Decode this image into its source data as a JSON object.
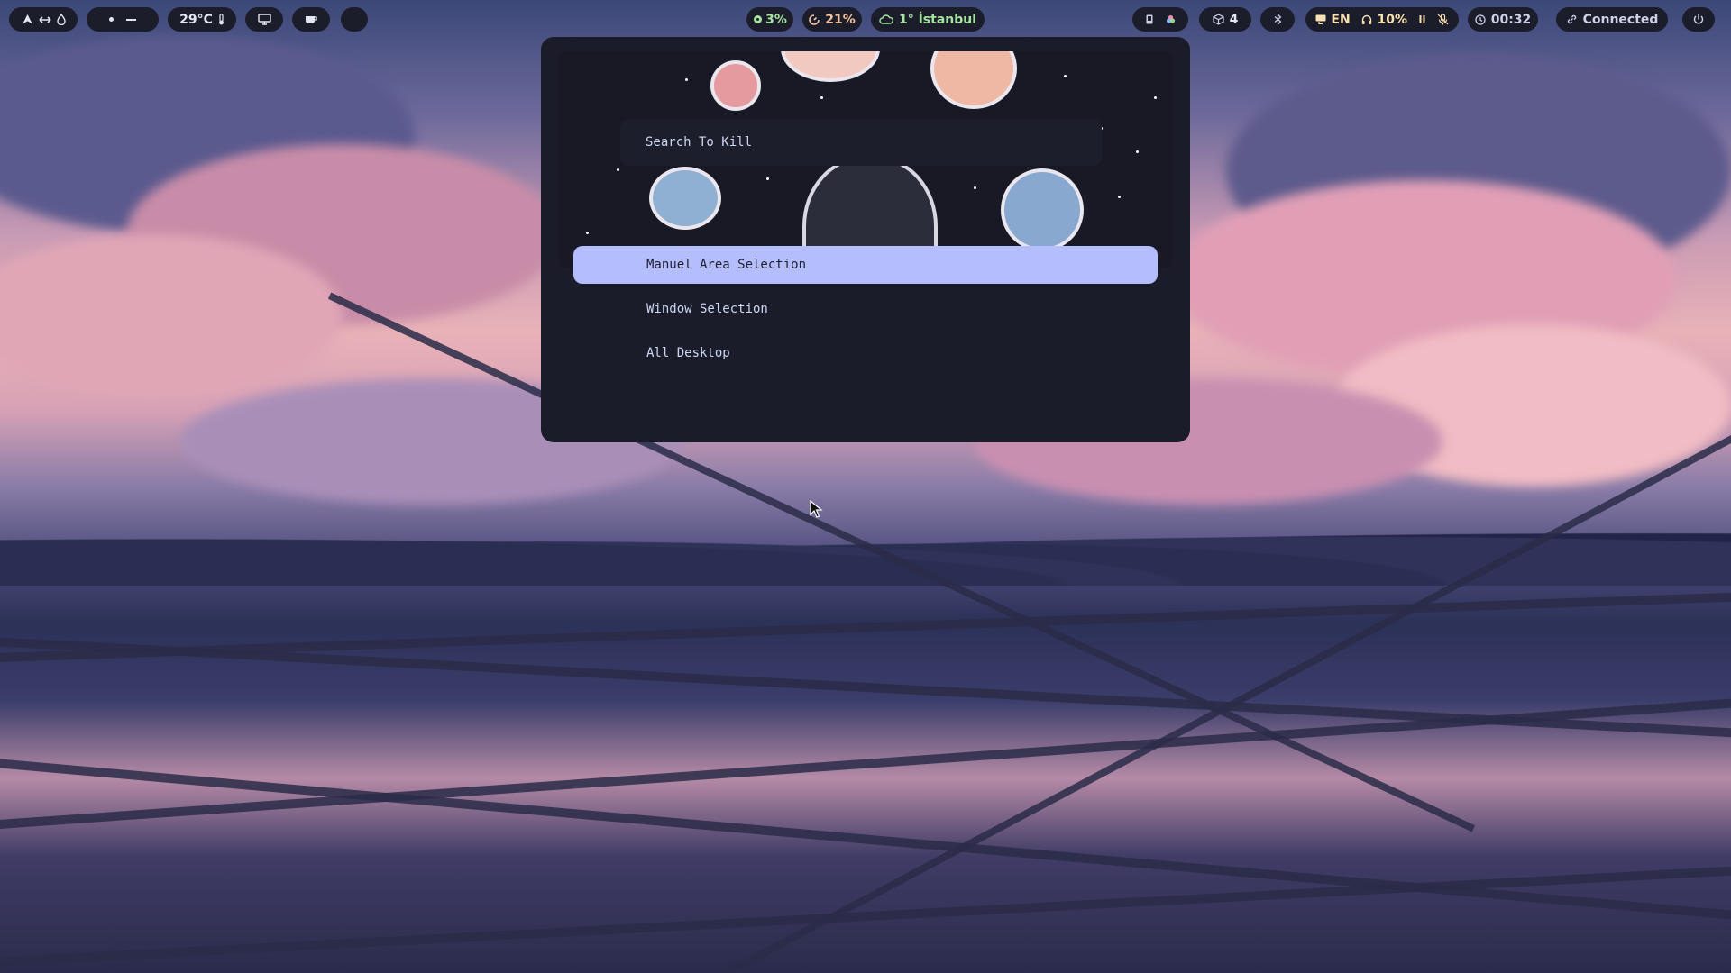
{
  "topbar": {
    "left": {
      "weather_temp": "29°C"
    },
    "center": {
      "cpu": "3%",
      "memory": "21%",
      "weather": "1° İstanbul"
    },
    "right": {
      "updates": "4",
      "language": "EN",
      "volume": "10%",
      "clock": "00:32",
      "network": "Connected"
    }
  },
  "launcher": {
    "search_placeholder": "Search To Kill",
    "items": [
      {
        "label": "Manuel Area Selection",
        "selected": true
      },
      {
        "label": "Window Selection",
        "selected": false
      },
      {
        "label": "All Desktop",
        "selected": false
      }
    ],
    "selected_color": "#b4befe"
  },
  "icons": {
    "arch": "arch-logo-icon",
    "workspaces": "workspace-dots-icon",
    "thermometer": "thermometer-icon",
    "monitor": "monitor-icon",
    "coffee": "coffee-icon",
    "cpu": "cpu-icon",
    "memory": "memory-icon",
    "cloud": "cloud-icon",
    "updates": "package-icon",
    "bluetooth": "bluetooth-icon",
    "keyboard": "keyboard-icon",
    "headphones": "headphones-icon",
    "mic_muted": "mic-muted-icon",
    "clock": "clock-icon",
    "link": "link-icon",
    "power": "power-icon"
  }
}
